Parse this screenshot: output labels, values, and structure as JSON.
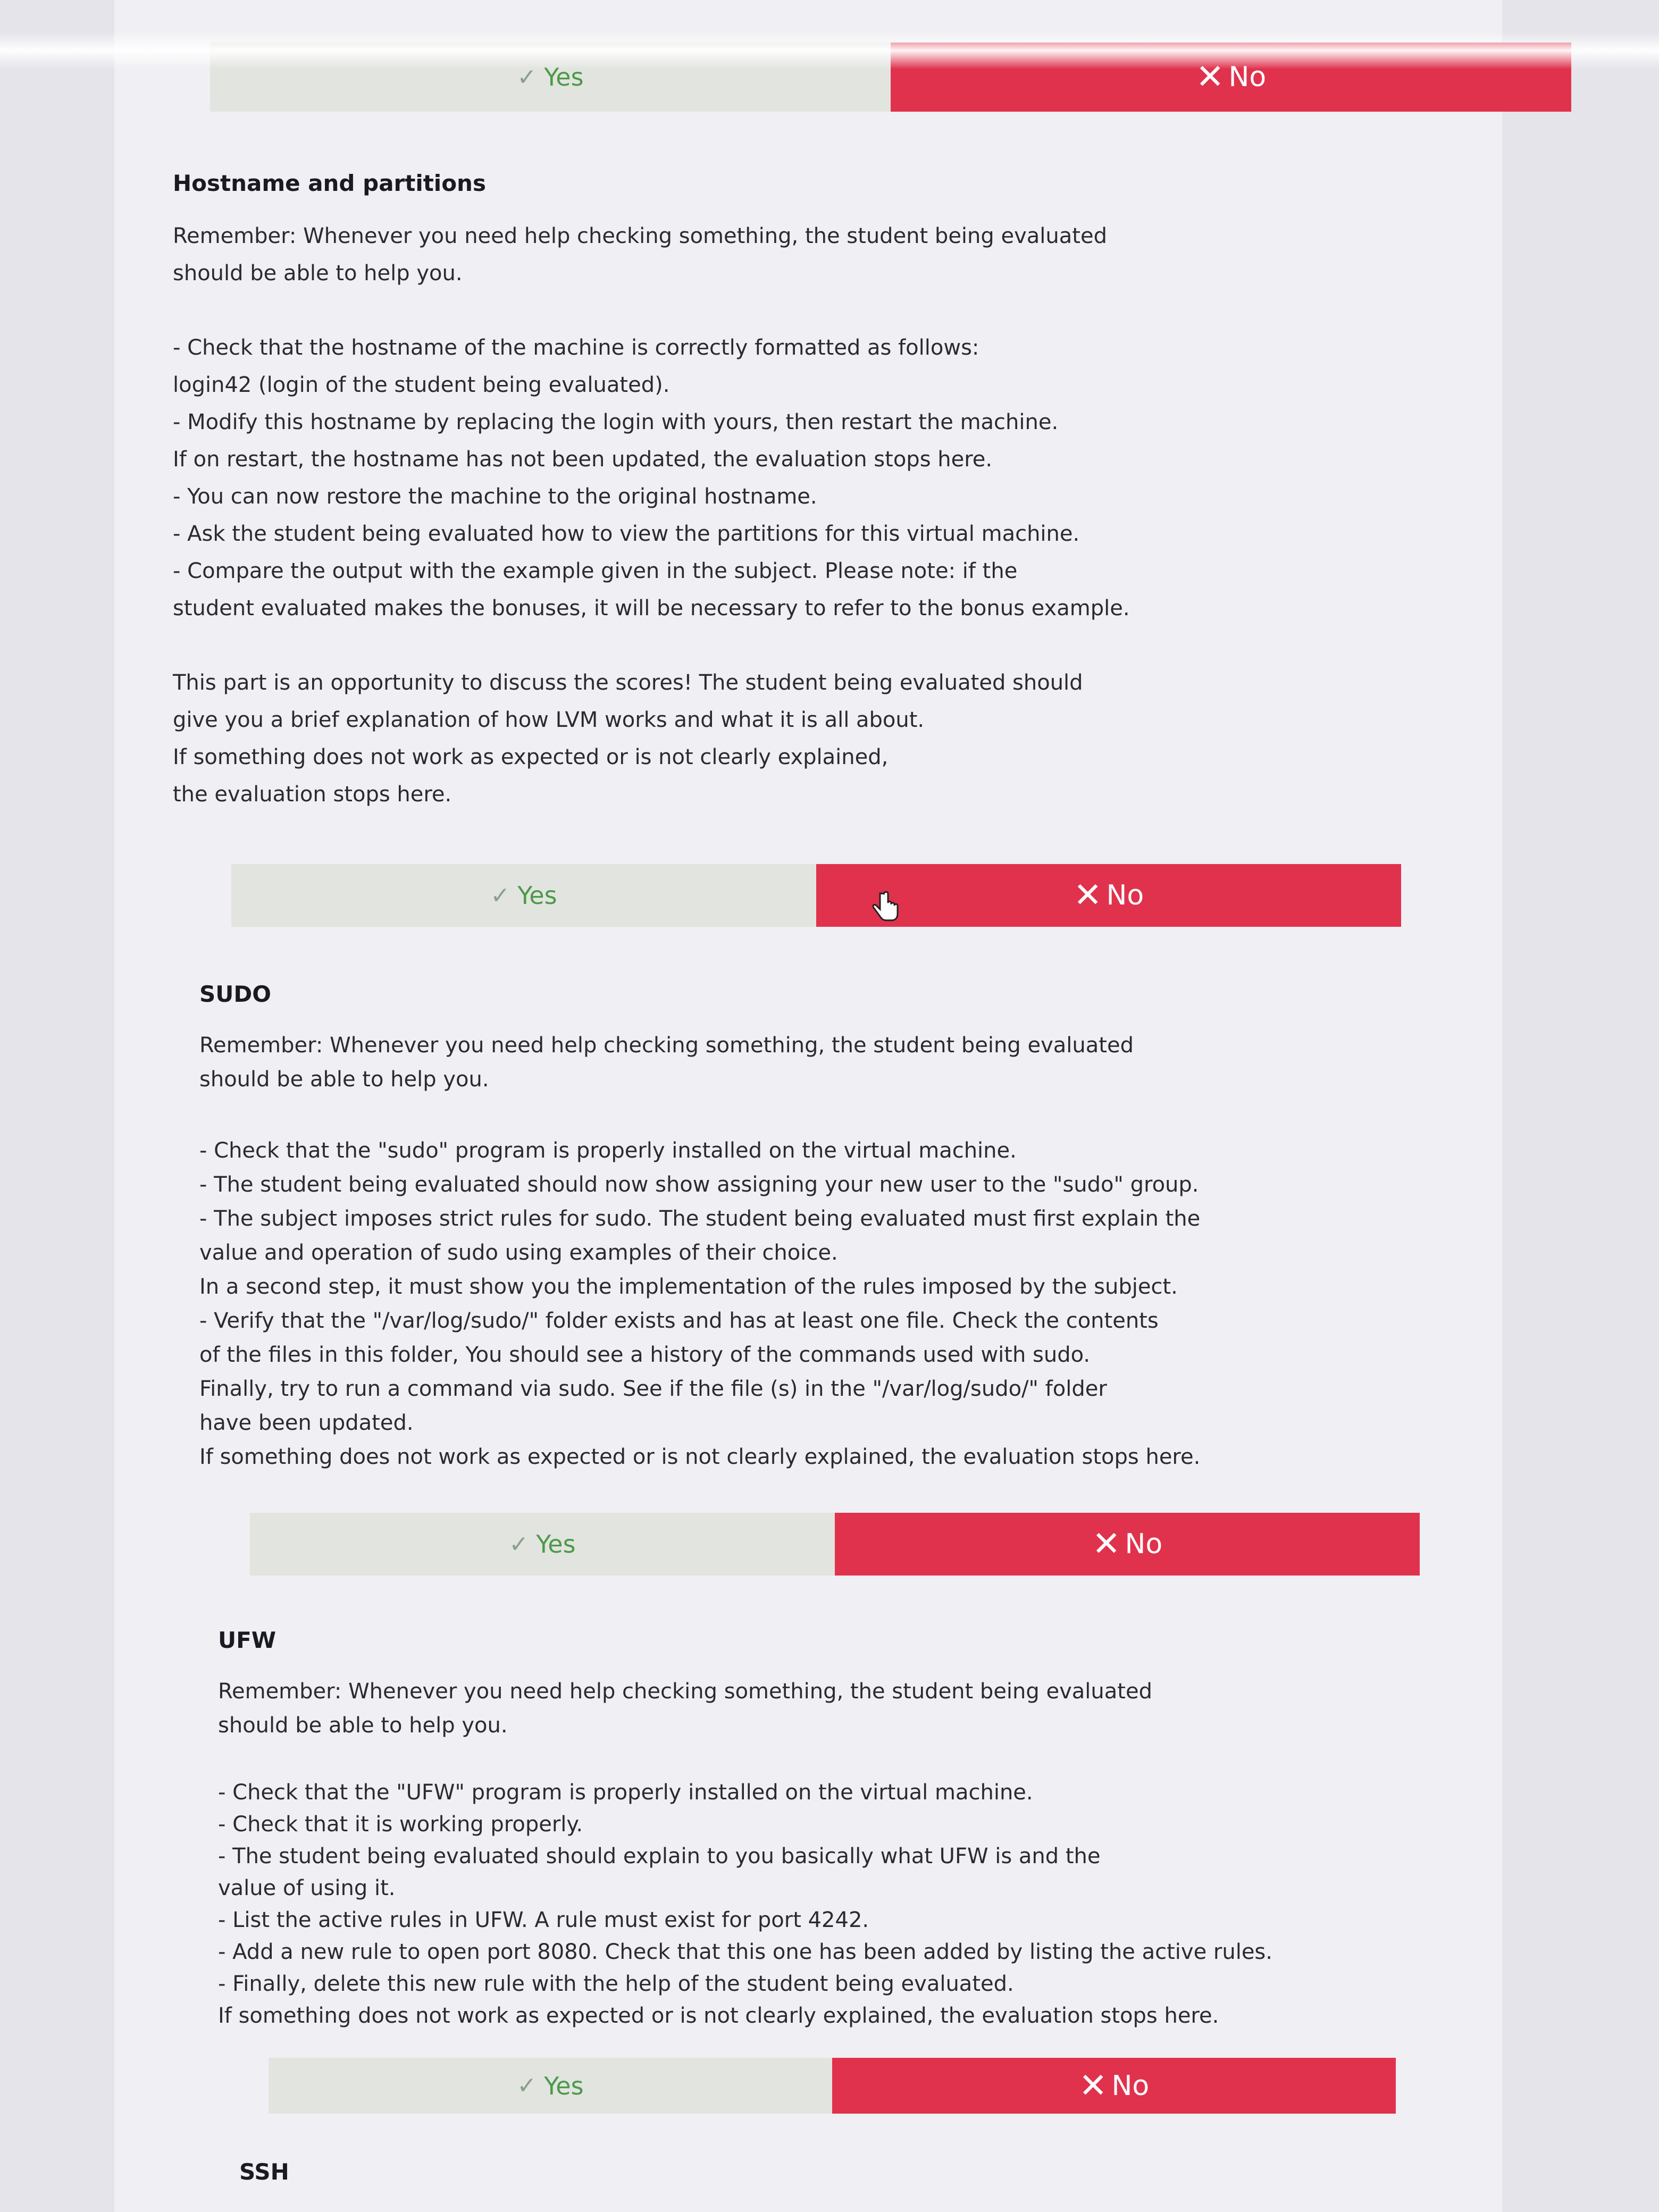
{
  "vote": {
    "yes_label": "Yes",
    "no_label": "No"
  },
  "hostname": {
    "title": "Hostname and partitions",
    "p1": "Remember: Whenever you need help checking something, the student being evaluated\nshould be able to help you.",
    "p2": "- Check that the hostname of the machine is correctly formatted as follows:\nlogin42 (login of the student being evaluated).\n- Modify this hostname by replacing the login with yours, then restart the machine.\nIf on restart, the hostname has not been updated, the evaluation stops here.\n- You can now restore the machine to the original hostname.\n- Ask the student being evaluated how to view the partitions for this virtual machine.\n- Compare the output with the example given in the subject. Please note: if the\nstudent evaluated makes the bonuses, it will be necessary to refer to the bonus example.",
    "p3": "This part is an opportunity to discuss the scores! The student being evaluated should\ngive you a brief explanation of how LVM works and what it is all about.\nIf something does not work as expected or is not clearly explained,\nthe evaluation stops here."
  },
  "sudo": {
    "title": "SUDO",
    "p1": "Remember: Whenever you need help checking something, the student being evaluated\nshould be able to help you.",
    "p2": "- Check that the \"sudo\" program is properly installed on the virtual machine.\n- The student being evaluated should now show assigning your new user to the \"sudo\" group.\n- The subject imposes strict rules for sudo. The student being evaluated must first explain the\nvalue and operation of sudo using examples of their choice.\nIn a second step, it must show you the implementation of the rules imposed by the subject.\n- Verify that the \"/var/log/sudo/\" folder exists and has at least one file. Check the contents\nof the files in this folder, You should see a history of the commands used with sudo.\nFinally, try to run a command via sudo. See if the file (s) in the \"/var/log/sudo/\" folder\nhave been updated.\nIf something does not work as expected or is not clearly explained, the evaluation stops here."
  },
  "ufw": {
    "title": "UFW",
    "p1": "Remember: Whenever you need help checking something, the student being evaluated\nshould be able to help you.",
    "p2": "- Check that the \"UFW\" program is properly installed on the virtual machine.\n- Check that it is working properly.\n- The student being evaluated should explain to you basically what UFW is and the\nvalue of using it.\n- List the active rules in UFW. A rule must exist for port 4242.\n- Add a new rule to open port 8080. Check that this one has been added by listing the active rules.\n- Finally, delete this new rule with the help of the student being evaluated.\nIf something does not work as expected or is not clearly explained, the evaluation stops here."
  },
  "ssh": {
    "title": "SSH"
  }
}
